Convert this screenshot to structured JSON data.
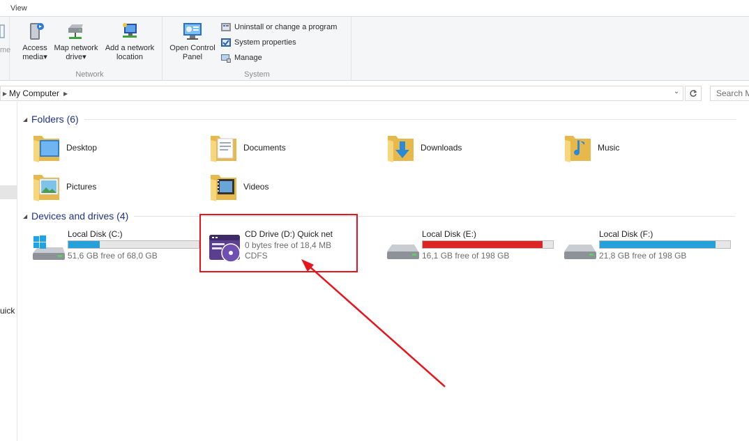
{
  "ribbon": {
    "tab_view": "View",
    "partial_label": "me",
    "network": {
      "access_media_line1": "Access",
      "access_media_line2": "media",
      "map_drive_line1": "Map network",
      "map_drive_line2": "drive",
      "add_location_line1": "Add a network",
      "add_location_line2": "location",
      "group_label": "Network"
    },
    "system": {
      "control_panel_line1": "Open Control",
      "control_panel_line2": "Panel",
      "uninstall": "Uninstall or change a program",
      "properties": "System properties",
      "manage": "Manage",
      "group_label": "System"
    },
    "dropdown_glyph": "▾"
  },
  "address": {
    "location": "My Computer",
    "search_placeholder": "Search My Computer"
  },
  "nav": {
    "quick_partial": "uick"
  },
  "folders": {
    "header": "Folders (6)",
    "items": [
      {
        "name": "Desktop"
      },
      {
        "name": "Documents"
      },
      {
        "name": "Downloads"
      },
      {
        "name": "Music"
      },
      {
        "name": "Pictures"
      },
      {
        "name": "Videos"
      }
    ]
  },
  "devices": {
    "header": "Devices and drives (4)",
    "drives": [
      {
        "name": "Local Disk (C:)",
        "free": "51,6 GB free of 68,0 GB",
        "used_fraction": 0.24,
        "bar_color": "#26a0da"
      },
      {
        "name": "CD Drive (D:) Quick net",
        "free": "0 bytes free of 18,4 MB",
        "fs": "CDFS"
      },
      {
        "name": "Local Disk (E:)",
        "free": "16,1 GB free of 198 GB",
        "used_fraction": 0.92,
        "bar_color": "#da2626"
      },
      {
        "name": "Local Disk (F:)",
        "free": "21,8 GB free of 198 GB",
        "used_fraction": 0.89,
        "bar_color": "#26a0da"
      }
    ]
  },
  "colors": {
    "accent_blue": "#26a0da",
    "warning_red": "#da2626",
    "annotation_red": "#e8141b",
    "section_title": "#1e3287"
  }
}
